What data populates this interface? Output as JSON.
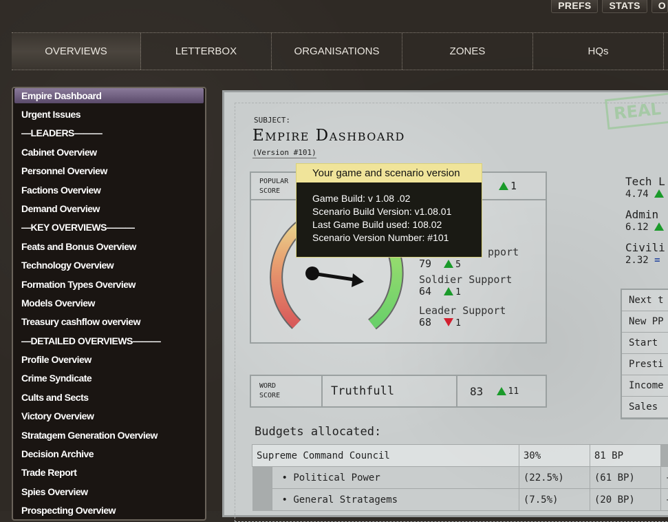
{
  "top_buttons": [
    "PREFS",
    "STATS",
    "O"
  ],
  "nav": [
    {
      "label": "OVERVIEWS",
      "active": true
    },
    {
      "label": "LETTERBOX"
    },
    {
      "label": "ORGANISATIONS"
    },
    {
      "label": "ZONES"
    },
    {
      "label": "HQs"
    }
  ],
  "sidebar": {
    "items": [
      "Empire Dashboard",
      "Urgent Issues",
      "—LEADERS———",
      "Cabinet Overview",
      "Personnel Overview",
      "Factions Overview",
      "Demand Overview",
      "—KEY OVERVIEWS———",
      "Feats and Bonus Overview",
      "Technology Overview",
      "Formation Types Overview",
      "Models Overview",
      "Treasury cashflow overview",
      "—DETAILED OVERVIEWS———",
      "Profile Overview",
      "Crime Syndicate",
      "Cults and Sects",
      "Victory Overview",
      "Stratagem Generation Overview",
      "Decision Archive",
      "Trade Report",
      "Spies Overview",
      "Prospecting Overview"
    ]
  },
  "paper": {
    "subject_label": "SUBJECT:",
    "title": "Empire Dashboard",
    "version": "(Version #101)",
    "stamp": "REAL",
    "popular_label_1": "POPULAR",
    "popular_label_2": "SCORE",
    "popular_delta": "1",
    "support_hidden_label": "pport",
    "support_1_value": "79",
    "support_1_delta": "5",
    "soldier_label": "Soldier Support",
    "soldier_value": "64",
    "soldier_delta": "1",
    "leader_label": "Leader Support",
    "leader_value": "68",
    "leader_delta": "1",
    "word_label_1": "WORD",
    "word_label_2": "SCORE",
    "word_value": "Truthfull",
    "word_score": "83",
    "word_delta": "11",
    "budget_title": "Budgets allocated:",
    "budget_rows": [
      {
        "name": "Supreme Command Council",
        "pct": "30%",
        "bp": "81 BP",
        "extra": ""
      },
      {
        "name": "• Political Power",
        "pct": "(22.5%)",
        "bp": "(61 BP)",
        "extra": "-"
      },
      {
        "name": "• General Stratagems",
        "pct": "(7.5%)",
        "bp": "(20 BP)",
        "extra": "-"
      }
    ],
    "right_stats": [
      {
        "label": "Tech L",
        "value": "4.74"
      },
      {
        "label": "Admin",
        "value": "6.12"
      },
      {
        "label": "Civili",
        "value": "2.32"
      }
    ],
    "right_buttons": [
      "Next t",
      "New PP",
      "Start",
      "Presti",
      "Income",
      "Sales"
    ]
  },
  "tooltip": {
    "title": "Your game and scenario version",
    "lines": [
      "Game Build: v 1.08 .02",
      "Scenario Build Version: v1.08.01",
      "Last Game Build used: 108.02",
      "Scenario Version Number: #101"
    ]
  }
}
